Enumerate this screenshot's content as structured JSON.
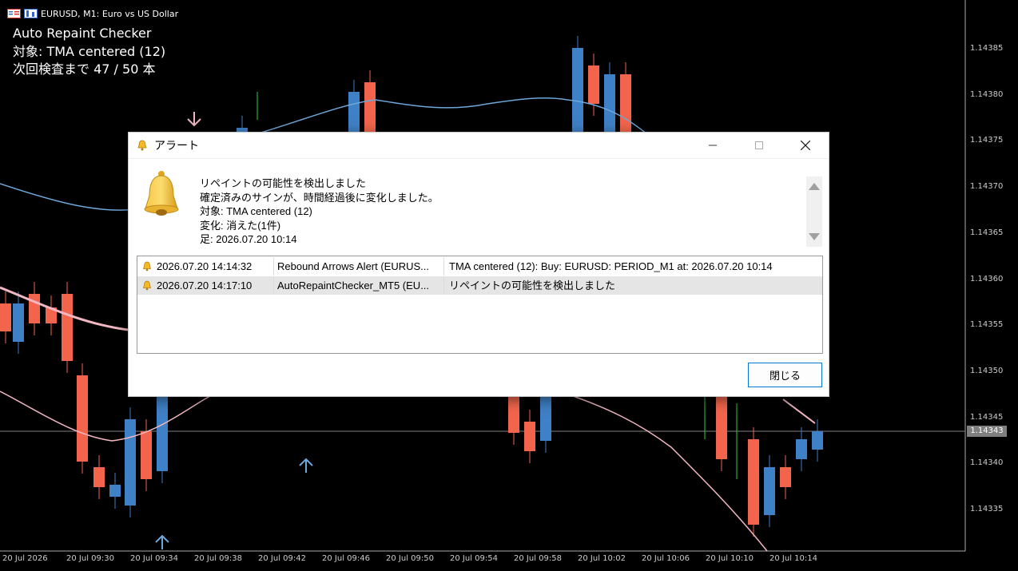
{
  "chart": {
    "symbol_line": "EURUSD, M1:  Euro vs US Dollar",
    "info": {
      "title": "Auto Repaint Checker",
      "target": "対象:  TMA centered (12)",
      "next_check": "次回検査まで 47 / 50 本"
    },
    "price_labels": [
      "1.14385",
      "1.14380",
      "1.14375",
      "1.14370",
      "1.14365",
      "1.14360",
      "1.14355",
      "1.14350",
      "1.14345",
      "1.14340",
      "1.14335"
    ],
    "current_price": "1.14343",
    "time_labels": [
      "20 Jul 2026",
      "20 Jul 09:30",
      "20 Jul 09:34",
      "20 Jul 09:38",
      "20 Jul 09:42",
      "20 Jul 09:46",
      "20 Jul 09:50",
      "20 Jul 09:54",
      "20 Jul 09:58",
      "20 Jul 10:02",
      "20 Jul 10:06",
      "20 Jul 10:10",
      "20 Jul 10:14"
    ],
    "colors": {
      "bull": "#3f81c6",
      "bear": "#f2654c",
      "band": "#6ea7d9",
      "tma": "#f2b7c2",
      "arrow_up": "#6ea7d9",
      "arrow_down": "#f2b7c2",
      "green": "#33cc33"
    }
  },
  "dialog": {
    "title": "アラート",
    "message_lines": [
      "リペイントの可能性を検出しました",
      "確定済みのサインが、時間経過後に変化しました。",
      "対象:  TMA centered (12)",
      "変化: 消えた(1件)",
      "足: 2026.07.20 10:14"
    ],
    "alerts": [
      {
        "time": "2026.07.20 14:14:32",
        "source": "Rebound Arrows Alert (EURUS...",
        "message": " TMA centered (12): Buy: EURUSD: PERIOD_M1 at: 2026.07.20 10:14"
      },
      {
        "time": "2026.07.20 14:17:10",
        "source": "AutoRepaintChecker_MT5 (EU...",
        "message": "リペイントの可能性を検出しました"
      }
    ],
    "close_label": "閉じる"
  }
}
